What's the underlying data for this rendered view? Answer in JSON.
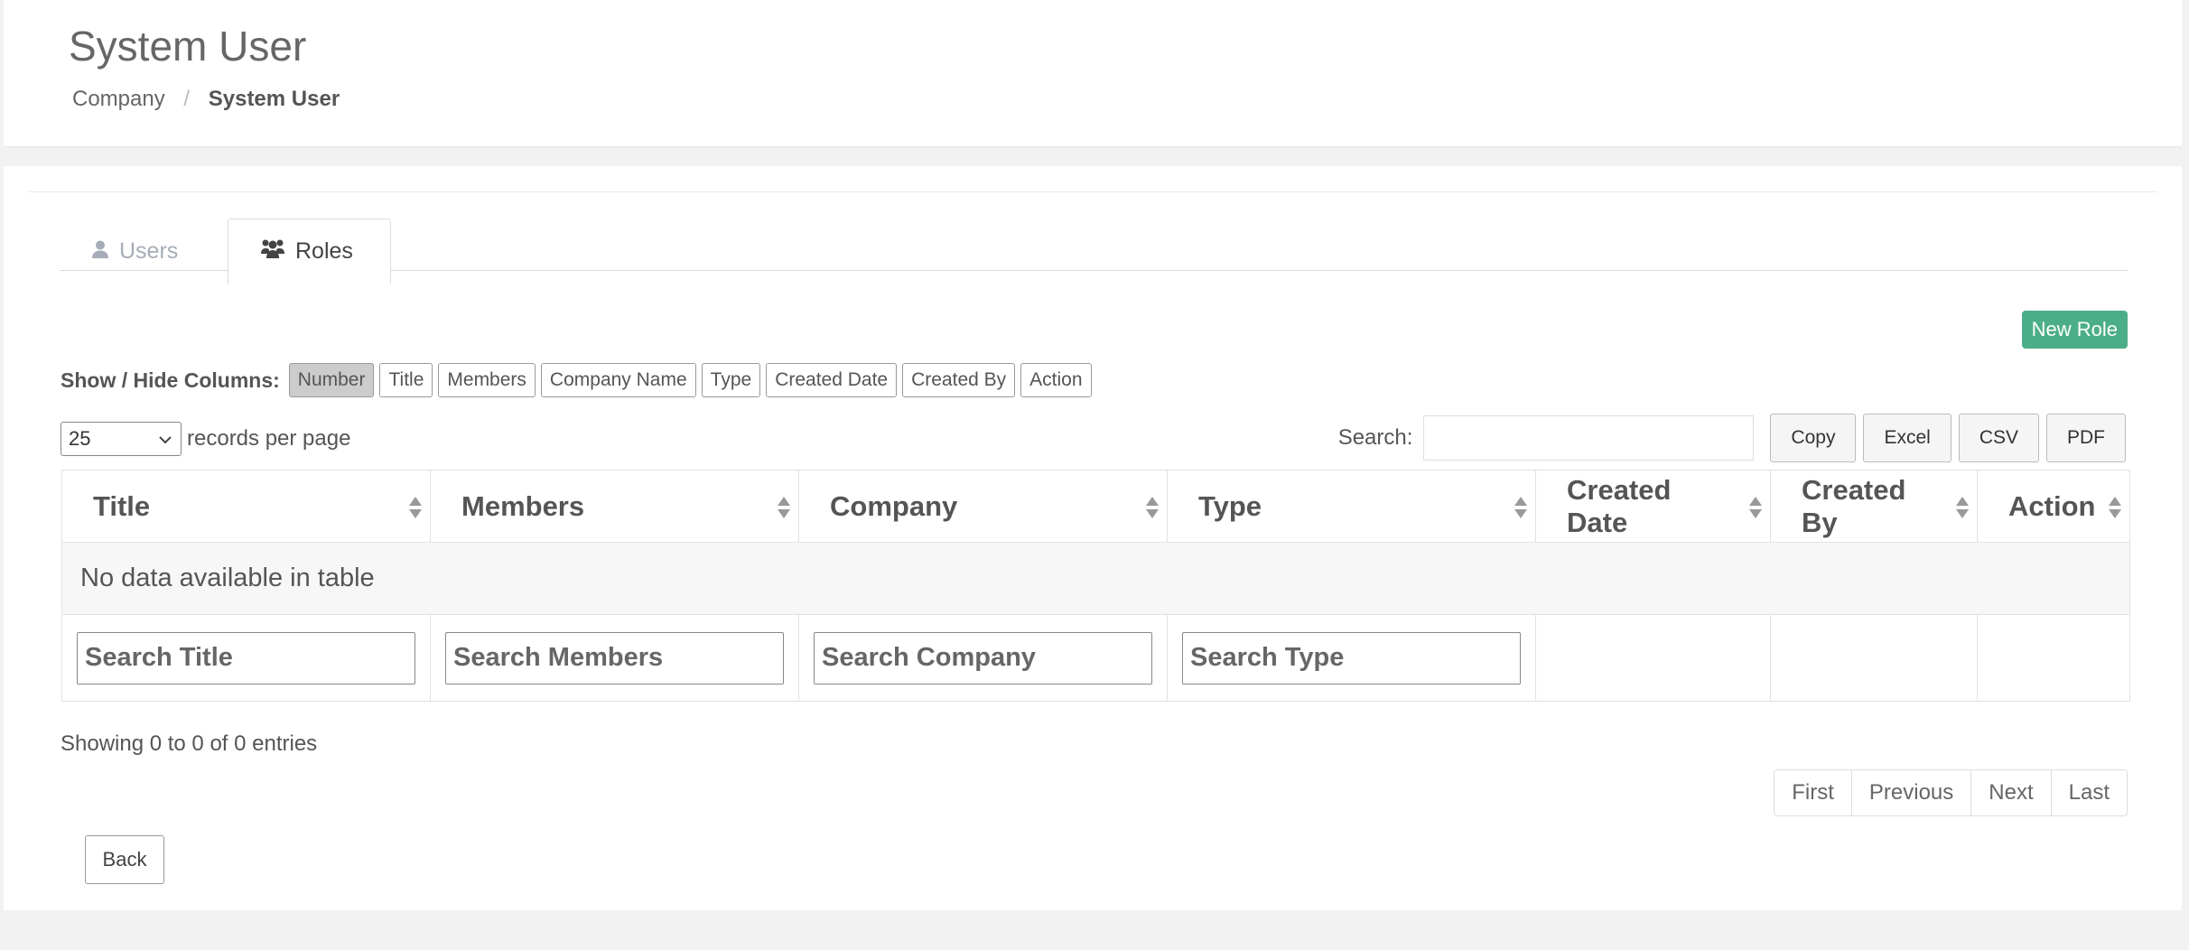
{
  "page": {
    "title": "System User"
  },
  "breadcrumb": {
    "items": [
      "Company",
      "System User"
    ]
  },
  "tabs": [
    {
      "label": "Users",
      "icon": "user-icon",
      "active": false
    },
    {
      "label": "Roles",
      "icon": "users-icon",
      "active": true
    }
  ],
  "actions": {
    "new_role_label": "New Role"
  },
  "column_visibility": {
    "label": "Show / Hide Columns:",
    "buttons": [
      "Number",
      "Title",
      "Members",
      "Company Name",
      "Type",
      "Created Date",
      "Created By",
      "Action"
    ],
    "active": "Number"
  },
  "length": {
    "value": "25",
    "suffix": "records per page"
  },
  "search": {
    "label": "Search:",
    "value": ""
  },
  "exports": [
    "Copy",
    "Excel",
    "CSV",
    "PDF"
  ],
  "table": {
    "columns": [
      "Title",
      "Members",
      "Company",
      "Type",
      "Created Date",
      "Created By",
      "Action"
    ],
    "empty_message": "No data available in table",
    "filters": [
      "Search Title",
      "Search Members",
      "Search Company",
      "Search Type"
    ]
  },
  "info": "Showing 0 to 0 of 0 entries",
  "pagination": [
    "First",
    "Previous",
    "Next",
    "Last"
  ],
  "back_label": "Back",
  "colors": {
    "accent_green": "#4cae88",
    "active_column_button": "#cccccc"
  }
}
